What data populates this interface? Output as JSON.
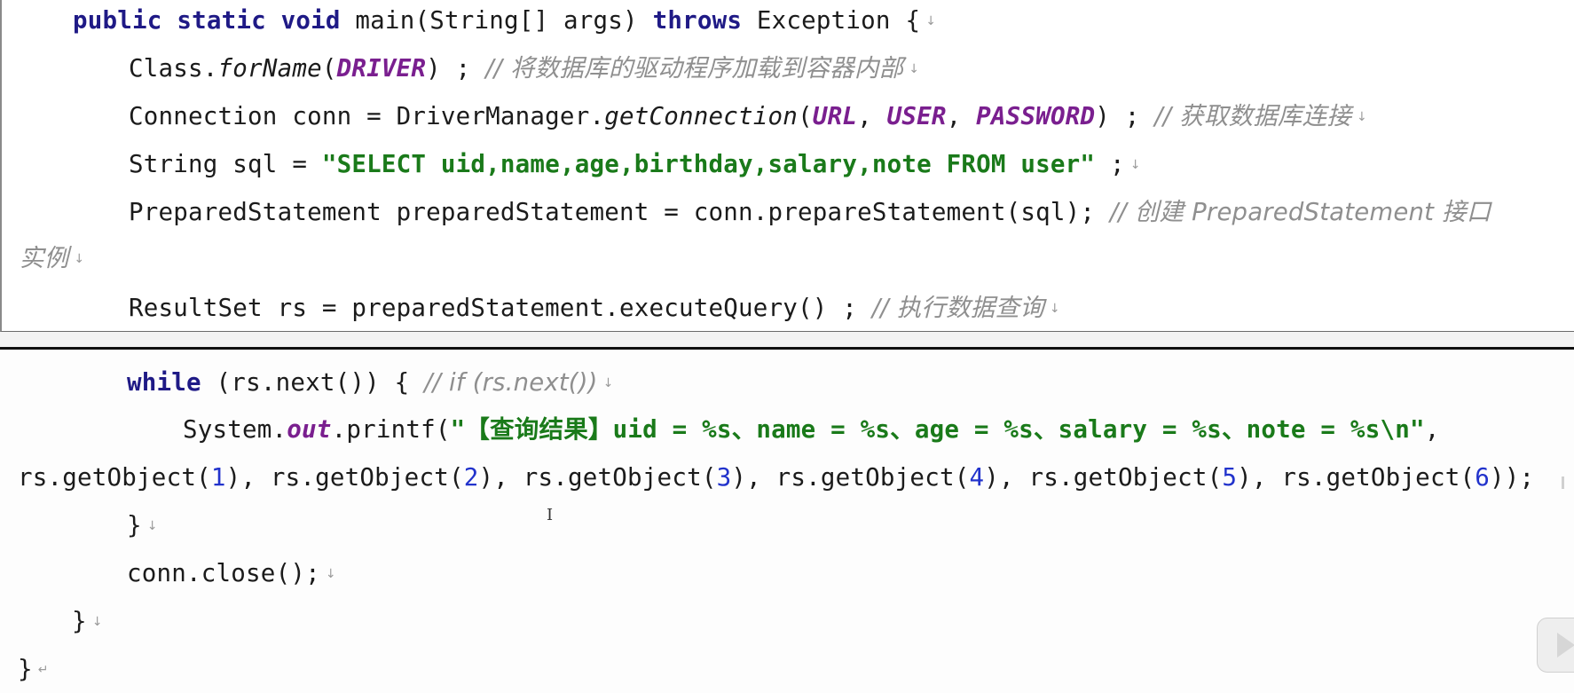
{
  "code_top": {
    "line1": {
      "kw1": "public",
      "kw2": "static",
      "kw3": "void",
      "text1": "main(String[] args)",
      "kw4": "throws",
      "text2": "Exception {"
    },
    "line2": {
      "text1": "Class.",
      "method": "forName",
      "text2": "(",
      "const": "DRIVER",
      "text3": ") ; ",
      "comment": "// 将数据库的驱动程序加载到容器内部"
    },
    "line3": {
      "text1": "Connection conn = DriverManager.",
      "method": "getConnection",
      "text2": "(",
      "const1": "URL",
      "sep1": ", ",
      "const2": "USER",
      "sep2": ", ",
      "const3": "PASSWORD",
      "text3": ") ; ",
      "comment": "// 获取数据库连接"
    },
    "line4": {
      "text1": "String sql = ",
      "string": "\"SELECT uid,name,age,birthday,salary,note FROM user\"",
      "text2": " ;"
    },
    "line5": {
      "text1": "PreparedStatement preparedStatement = conn.prepareStatement(sql); ",
      "comment": "// 创建 PreparedStatement 接口"
    },
    "line6": {
      "comment": "实例"
    },
    "line7": {
      "text1": "ResultSet rs = preparedStatement.executeQuery() ; ",
      "comment": "// 执行数据查询"
    }
  },
  "code_bottom": {
    "line1": {
      "kw": "while",
      "text1": " (rs.next()) { ",
      "comment": "// if (rs.next())"
    },
    "line2": {
      "text1": "System.",
      "field": "out",
      "text2": ".printf(",
      "string_open": "\"",
      "string_cjk": "【查询结果】",
      "string_rest": "uid = %s、name = %s、age = %s、salary = %s、note = %s\\n\"",
      "text3": ","
    },
    "line3": {
      "p1": "rs.getObject(",
      "n1": "1",
      "p2": "), rs.getObject(",
      "n2": "2",
      "p3": "), rs.getObject(",
      "n3": "3",
      "p4": "), rs.getObject(",
      "n4": "4",
      "p5": "), rs.getObject(",
      "n5": "5",
      "p6": "), rs.getObject(",
      "n6": "6",
      "p7": "));"
    },
    "line4": {
      "text": "}"
    },
    "line5": {
      "text": "conn.close();"
    },
    "line6": {
      "text": "}"
    },
    "line7": {
      "text": "}"
    }
  },
  "marks": {
    "paragraph": "↓",
    "paragraph_end": "↵"
  },
  "icons": {
    "text_cursor": "I-beam-cursor",
    "play": "play-icon"
  },
  "colors": {
    "keyword": "#1f1a86",
    "constant": "#7a1f8f",
    "string": "#1a7a1a",
    "number": "#2233cc",
    "comment": "#8f8f8f"
  }
}
